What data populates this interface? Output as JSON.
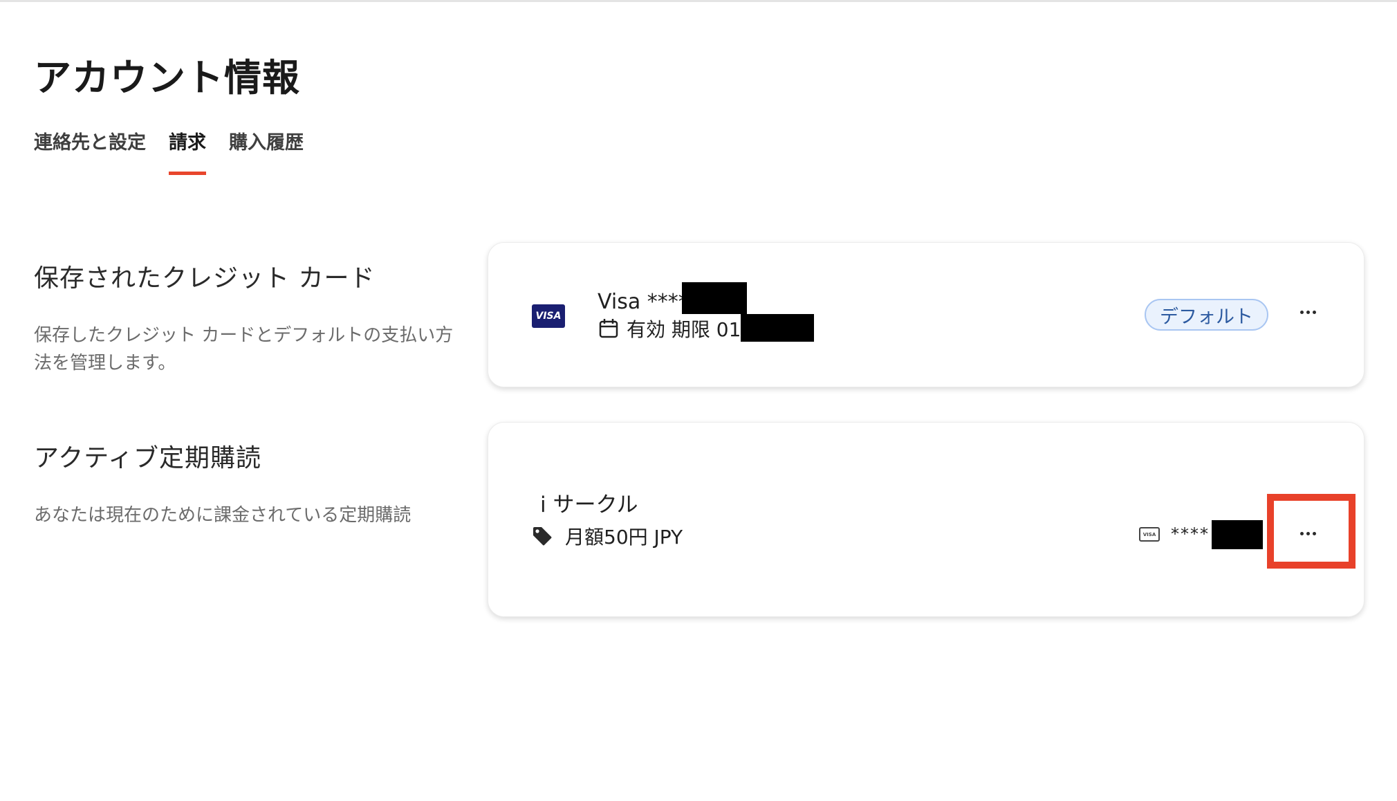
{
  "page_title": "アカウント情報",
  "tabs": [
    {
      "label": "連絡先と設定",
      "active": false
    },
    {
      "label": "請求",
      "active": true
    },
    {
      "label": "購入履歴",
      "active": false
    }
  ],
  "saved_cards": {
    "title": "保存されたクレジット カード",
    "description": "保存したクレジット カードとデフォルトの支払い方法を管理します。",
    "card": {
      "logo_text": "VISA",
      "brand_label": "Visa ****",
      "expiry_label": "有効 期限 01/",
      "default_badge": "デフォルト",
      "icons": {
        "logo": "visa-logo",
        "expiry": "calendar-icon",
        "menu": "more-horizontal-icon"
      }
    }
  },
  "subscriptions": {
    "title": "アクティブ定期購読",
    "description": "あなたは現在のために課金されている定期購読",
    "item": {
      "name": "i サークル",
      "price": "月額50円 JPY",
      "payment_logo_text": "VISA",
      "payment_card_mask": "****",
      "icons": {
        "price": "price-tag-icon",
        "payment": "visa-card-icon",
        "menu": "more-horizontal-icon"
      }
    }
  },
  "colors": {
    "accent": "#e8452c",
    "highlight": "#e8412a",
    "badge_border": "#a9c6f2",
    "badge_bg": "#eaf2fd",
    "visa_blue": "#1a1f71"
  }
}
